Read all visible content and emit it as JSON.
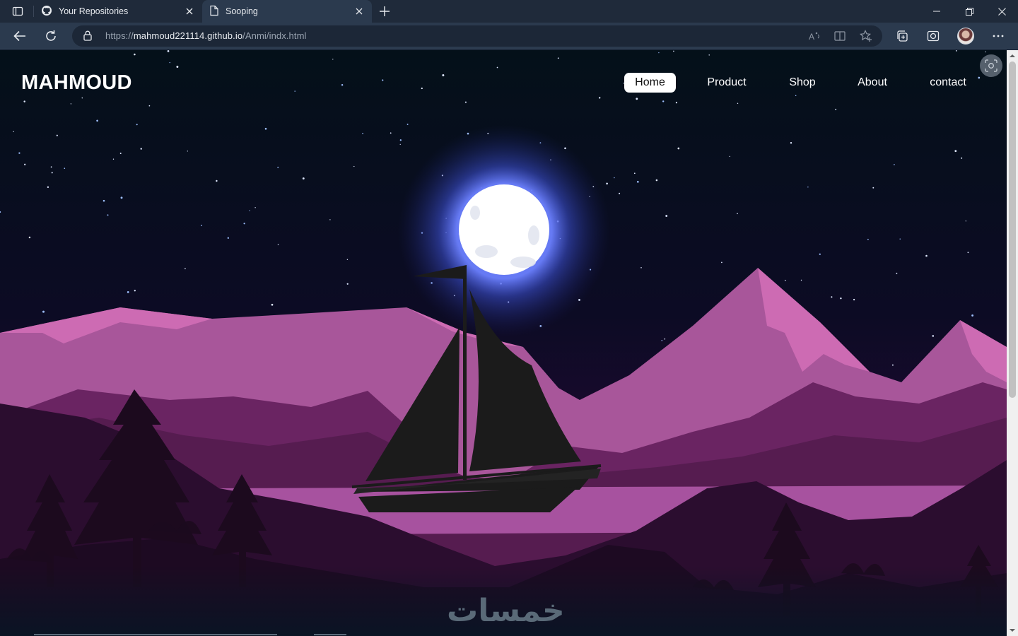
{
  "browser": {
    "tabs": [
      {
        "title": "Your Repositories",
        "icon": "github-icon",
        "active": false
      },
      {
        "title": "Sooping",
        "icon": "page-icon",
        "active": true
      }
    ],
    "url": {
      "protocol": "https://",
      "host": "mahmoud221114.github.io",
      "path": "/Anmi/indx.html"
    }
  },
  "site": {
    "brand": "MAHMOUD",
    "nav": [
      {
        "label": "Home",
        "active": true
      },
      {
        "label": "Product"
      },
      {
        "label": "Shop"
      },
      {
        "label": "About"
      },
      {
        "label": "contact"
      }
    ]
  },
  "watermark": "خمسات",
  "colors": {
    "sky": "#05101c",
    "moon": "#ffffff",
    "moon_glow": "#4f6cff",
    "mountain_light": "#c864b0",
    "mountain_mid": "#a8569a",
    "mountain_dark": "#5e2058",
    "ground": "#2a0c2e",
    "boat": "#1b1b1b"
  }
}
